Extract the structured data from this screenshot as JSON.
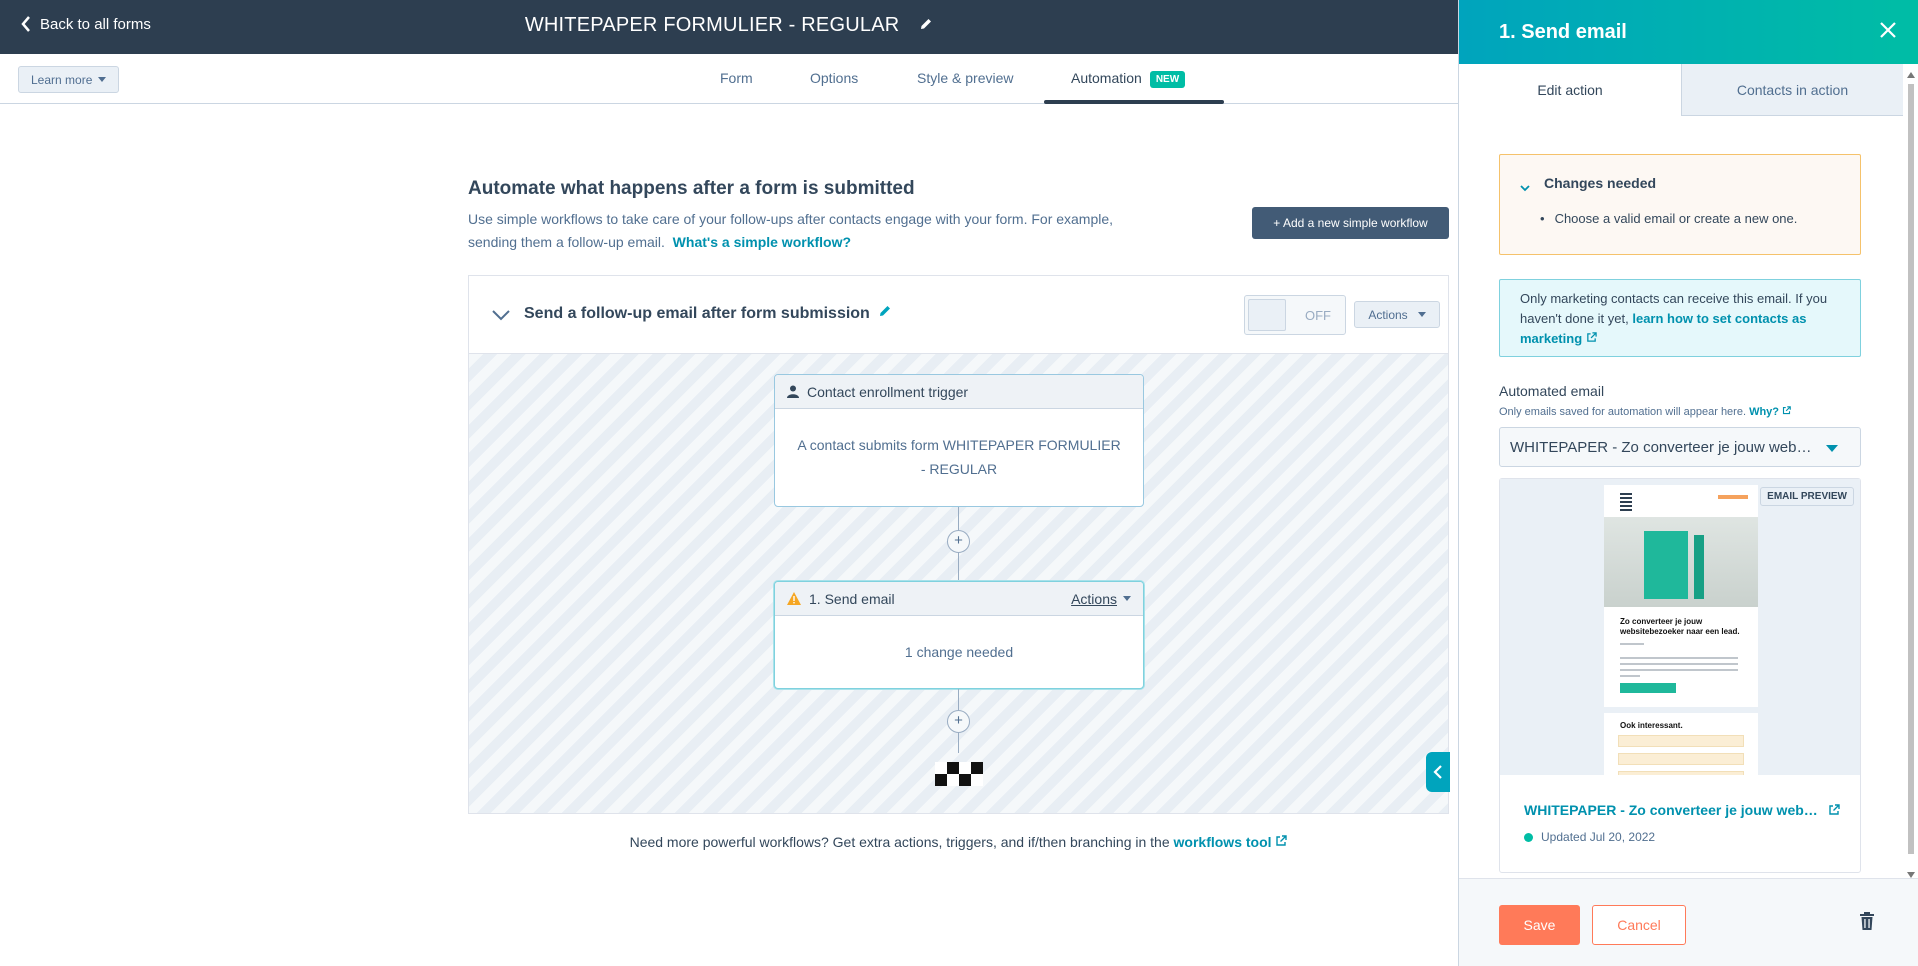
{
  "topbar": {
    "back_label": "Back to all forms",
    "form_title": "WHITEPAPER FORMULIER - REGULAR"
  },
  "subnav": {
    "learn_more": "Learn more",
    "tabs": [
      {
        "label": "Form"
      },
      {
        "label": "Options"
      },
      {
        "label": "Style & preview"
      },
      {
        "label": "Automation",
        "badge": "NEW",
        "active": true
      }
    ]
  },
  "main": {
    "heading": "Automate what happens after a form is submitted",
    "description": "Use simple workflows to take care of your follow-ups after contacts engage with your form. For example, sending them a follow-up email.",
    "description_link": "What's a simple workflow?",
    "add_button": "+ Add a new simple workflow",
    "footnote": "Need more powerful workflows? Get extra actions, triggers, and if/then branching in the",
    "footnote_link": "workflows tool"
  },
  "workflow": {
    "title": "Send a follow-up email after form submission",
    "toggle_state": "OFF",
    "actions_label": "Actions",
    "trigger": {
      "header": "Contact enrollment trigger",
      "body": "A contact submits form WHITEPAPER FORMULIER - REGULAR"
    },
    "action": {
      "header": "1. Send email",
      "actions_label": "Actions",
      "body": "1 change needed"
    }
  },
  "panel": {
    "title": "1. Send email",
    "tabs": [
      {
        "label": "Edit action",
        "active": true
      },
      {
        "label": "Contacts in action",
        "active": false
      }
    ],
    "changes": {
      "title": "Changes needed",
      "items": [
        "Choose a valid email or create a new one."
      ]
    },
    "info": {
      "text": "Only marketing contacts can receive this email. If you haven't done it yet,",
      "link": "learn how to set contacts as marketing"
    },
    "automated_email": {
      "label": "Automated email",
      "help": "Only emails saved for automation will appear here.",
      "help_link": "Why?",
      "selected": "WHITEPAPER - Zo converteer je jouw websitebezoeker naar een lead",
      "preview_badge": "EMAIL PREVIEW",
      "preview_heading": "Zo converteer je jouw websitebezoeker naar een lead.",
      "preview_section2": "Ook interessant.",
      "email_name": "WHITEPAPER - Zo converteer je jouw websitebezoeker naar een lead",
      "updated": "Updated Jul 20, 2022"
    },
    "footer": {
      "save": "Save",
      "cancel": "Cancel"
    }
  },
  "colors": {
    "topbar": "#2d3e50",
    "accent_teal": "#00bda5",
    "link": "#0091ae",
    "primary_orange": "#ff7a59",
    "warning_border": "#f5c26b"
  },
  "icons": [
    "chevron-left-icon",
    "pencil-icon",
    "chevron-down-icon",
    "person-icon",
    "warning-icon",
    "plus-icon",
    "checkered-flag-icon",
    "close-icon",
    "external-link-icon",
    "trash-icon"
  ]
}
